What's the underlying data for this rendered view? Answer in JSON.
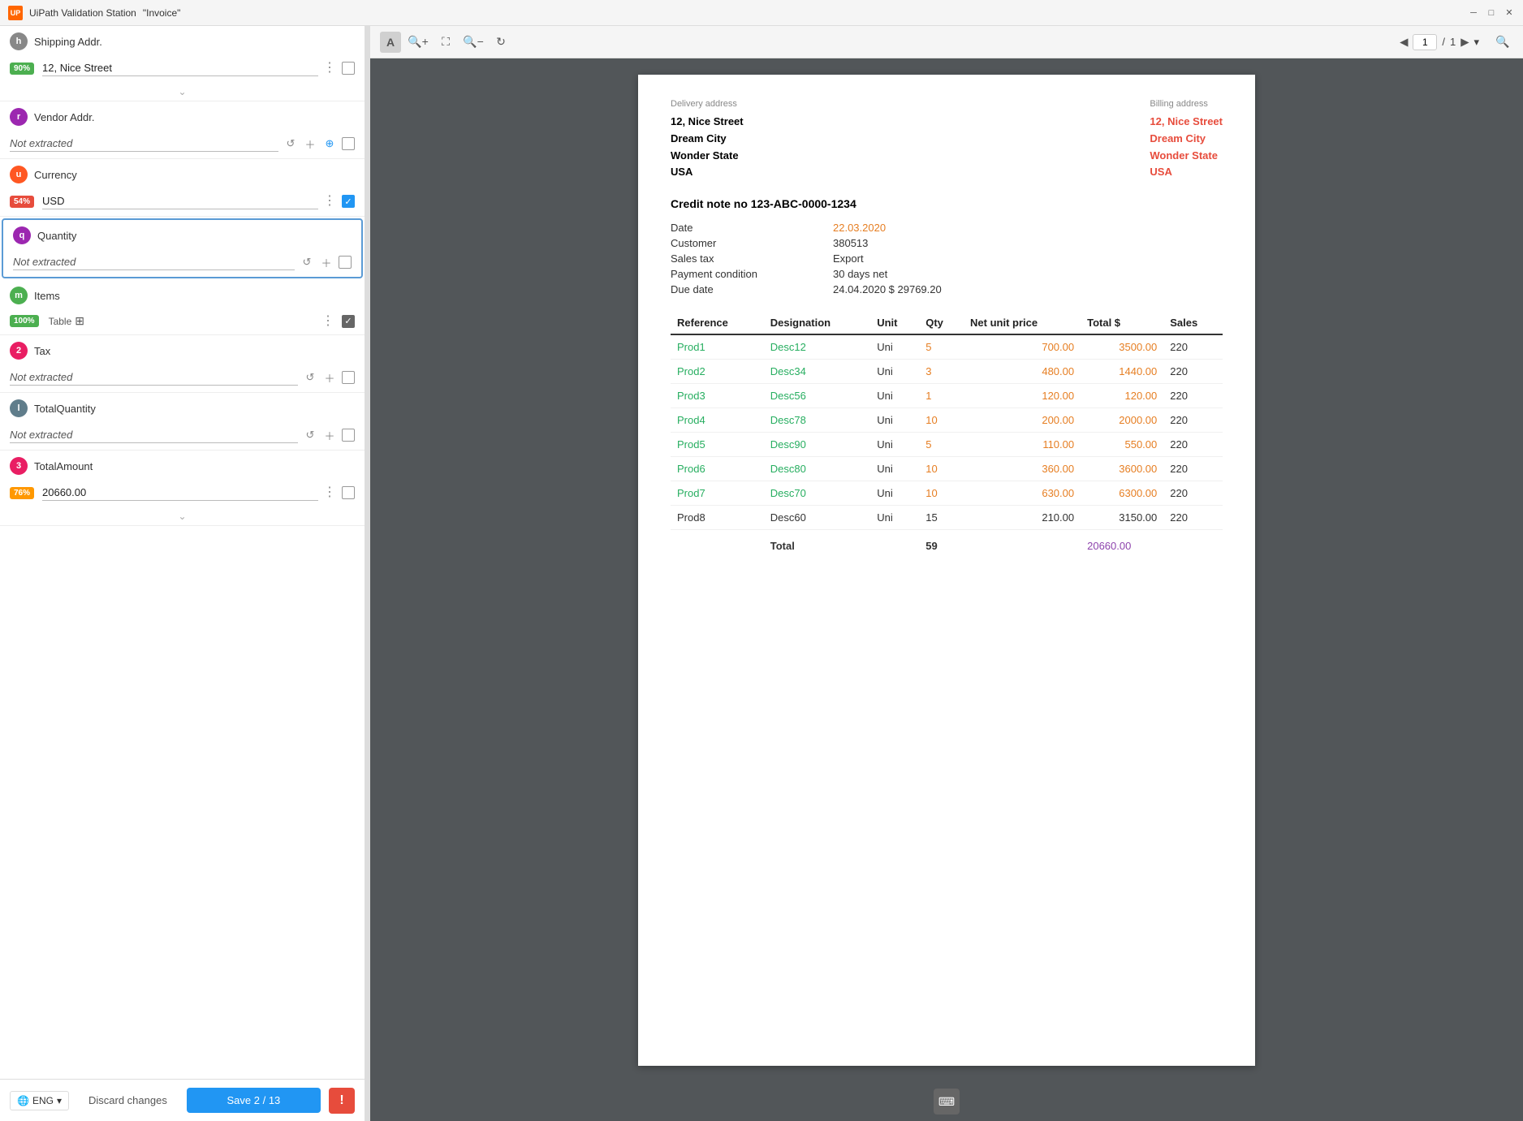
{
  "titlebar": {
    "app_name": "UiPath Validation Station",
    "doc_name": "\"Invoice\"",
    "logo_text": "UP"
  },
  "left_panel": {
    "fields": [
      {
        "id": "shipping-addr",
        "letter": "h",
        "letter_color": "#888",
        "name": "Shipping Addr.",
        "confidence": "90%",
        "conf_class": "conf-green",
        "value": "12, Nice Street",
        "has_value": true,
        "show_dots": true,
        "show_checkbox": true,
        "checkbox_checked": false
      },
      {
        "id": "vendor-addr",
        "letter": "r",
        "letter_color": "#9c27b0",
        "name": "Vendor Addr.",
        "confidence": null,
        "value": "Not extracted",
        "has_value": false,
        "show_undo": true,
        "show_add": true,
        "show_circle": true,
        "show_checkbox": true
      },
      {
        "id": "currency",
        "letter": "u",
        "letter_color": "#ff5722",
        "name": "Currency",
        "confidence": "54%",
        "conf_class": "conf-red",
        "value": "USD",
        "has_value": true,
        "show_dots": true,
        "show_checkbox": true,
        "checkbox_checked": true
      },
      {
        "id": "quantity",
        "letter": "q",
        "letter_color": "#9c27b0",
        "name": "Quantity",
        "confidence": null,
        "value": "Not extracted",
        "has_value": false,
        "show_undo": true,
        "show_add": true,
        "show_checkbox": true,
        "highlighted": true
      },
      {
        "id": "tax",
        "letter": "2",
        "letter_color": "#e91e63",
        "name": "Tax",
        "confidence": null,
        "value": "Not extracted",
        "has_value": false,
        "show_undo": true,
        "show_add": true,
        "show_checkbox": true
      },
      {
        "id": "total-quantity",
        "letter": "l",
        "letter_color": "#607d8b",
        "name": "TotalQuantity",
        "confidence": null,
        "value": "Not extracted",
        "has_value": false,
        "show_undo": true,
        "show_add": true,
        "show_checkbox": true
      },
      {
        "id": "total-amount",
        "letter": "3",
        "letter_color": "#e91e63",
        "name": "TotalAmount",
        "confidence": "76%",
        "conf_class": "conf-orange",
        "value": "20660.00",
        "has_value": true,
        "show_dots": true,
        "show_checkbox": true
      }
    ],
    "items": {
      "letter": "m",
      "letter_color": "#4caf50",
      "name": "Items",
      "confidence": "100%",
      "conf_class": "conf-green",
      "table_label": "Table",
      "show_grid": true,
      "show_dots": true,
      "show_checkbox": true,
      "checkbox_checked": true
    }
  },
  "bottom_bar": {
    "language": "ENG",
    "discard_label": "Discard changes",
    "save_label": "Save 2 / 13",
    "alert_label": "!"
  },
  "viewer": {
    "toolbar": {
      "text_icon": "A",
      "zoom_in_icon": "+",
      "zoom_out_icon": "-",
      "fit_icon": "⛶",
      "refresh_icon": "↻",
      "page_current": "1",
      "page_separator": "/",
      "page_total": "1",
      "search_icon": "🔍"
    },
    "document": {
      "delivery_address_label": "Delivery address",
      "billing_address_label": "Billing address",
      "delivery_address": {
        "line1": "12, Nice Street",
        "line2": "Dream City",
        "line3": "Wonder State",
        "line4": "USA"
      },
      "billing_address": {
        "line1": "12, Nice Street",
        "line2": "Dream City",
        "line3": "Wonder State",
        "line4": "USA"
      },
      "credit_note_label": "Credit note no 123-ABC-0000-1234",
      "fields": [
        {
          "label": "Date",
          "value": "22.03.2020",
          "style": "orange"
        },
        {
          "label": "Customer",
          "value": "380513",
          "style": ""
        },
        {
          "label": "Sales tax",
          "value": "Export",
          "style": ""
        },
        {
          "label": "Payment condition",
          "value": "30 days net",
          "style": ""
        },
        {
          "label": "Due date",
          "value": "24.04.2020 $ 29769.20",
          "style": ""
        }
      ],
      "table": {
        "headers": [
          "Reference",
          "Designation",
          "Unit",
          "Qty",
          "Net unit price",
          "Total $",
          "Sales"
        ],
        "rows": [
          {
            "ref": "Prod1",
            "desc": "Desc12",
            "unit": "Uni",
            "qty": "5",
            "net": "700.00",
            "total": "3500.00",
            "sales": "220",
            "green": true
          },
          {
            "ref": "Prod2",
            "desc": "Desc34",
            "unit": "Uni",
            "qty": "3",
            "net": "480.00",
            "total": "1440.00",
            "sales": "220",
            "green": true
          },
          {
            "ref": "Prod3",
            "desc": "Desc56",
            "unit": "Uni",
            "qty": "1",
            "net": "120.00",
            "total": "120.00",
            "sales": "220",
            "green": true
          },
          {
            "ref": "Prod4",
            "desc": "Desc78",
            "unit": "Uni",
            "qty": "10",
            "net": "200.00",
            "total": "2000.00",
            "sales": "220",
            "green": true
          },
          {
            "ref": "Prod5",
            "desc": "Desc90",
            "unit": "Uni",
            "qty": "5",
            "net": "110.00",
            "total": "550.00",
            "sales": "220",
            "green": true
          },
          {
            "ref": "Prod6",
            "desc": "Desc80",
            "unit": "Uni",
            "qty": "10",
            "net": "360.00",
            "total": "3600.00",
            "sales": "220",
            "green": true
          },
          {
            "ref": "Prod7",
            "desc": "Desc70",
            "unit": "Uni",
            "qty": "10",
            "net": "630.00",
            "total": "6300.00",
            "sales": "220",
            "green": true
          },
          {
            "ref": "Prod8",
            "desc": "Desc60",
            "unit": "Uni",
            "qty": "15",
            "net": "210.00",
            "total": "3150.00",
            "sales": "220",
            "green": false
          }
        ],
        "total_row": {
          "label": "Total",
          "qty": "59",
          "total": "20660.00"
        }
      }
    }
  }
}
